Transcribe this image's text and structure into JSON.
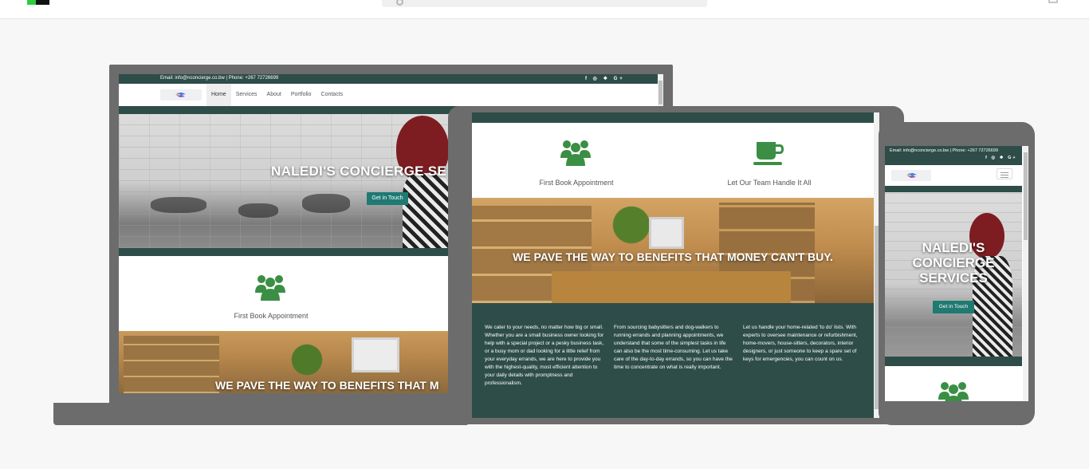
{
  "site": {
    "contact_line": "Email: info@nconcierge.co.bw | Phone: +267 72726699",
    "social_icons": [
      "facebook-icon",
      "instagram-icon",
      "twitter-icon",
      "google-plus-icon"
    ],
    "social_glyphs": "f ◎ ❖ G+",
    "nav": [
      "Home",
      "Services",
      "About",
      "Portfolio",
      "Contacts"
    ],
    "active_nav": "Home",
    "hero_title_laptop": "NALEDI'S CONCIERGE SE",
    "hero_title_phone": "NALEDI'S CONCIERGE SERVICES",
    "hero_button": "Get in Touch",
    "feature_1": "First Book Appointment",
    "feature_2": "Let Our Team Handle It All",
    "office_title_laptop": "WE PAVE THE WAY TO BENEFITS THAT M",
    "office_title_tablet": "WE PAVE THE WAY TO BENEFITS THAT MONEY CAN'T BUY.",
    "info_columns": [
      "We cater to your needs, no matter how big or small. Whether you are a small business owner looking for help with a special project or a pesky business task, or a busy mom or dad looking for a little relief from your everyday errands, we are here to provide you with the highest-quality, most efficient attention to your daily details with promptness and professionalism.",
      "From sourcing babysitters and dog-walkers to running errands and planning appointments, we understand that some of the simplest tasks in life can also be the most time-consuming. Let us take care of the day-to-day errands, so you can have the time to concentrate on what is really important.",
      "Let us handle your home-related 'to do' lists. With experts to oversee maintenance or refurbishment, home-movers, house-sitters, decorators, interior designers, or just someone to keep a spare set of keys for emergencies, you can count on us."
    ]
  },
  "colors": {
    "brand_dark_green": "#2e4d49",
    "button_teal": "#1f7a72",
    "icon_green": "#3a8f45",
    "device_gray": "#6c6c6c",
    "page_background": "#f7f7f7"
  },
  "devices": [
    "laptop",
    "tablet",
    "phone"
  ]
}
